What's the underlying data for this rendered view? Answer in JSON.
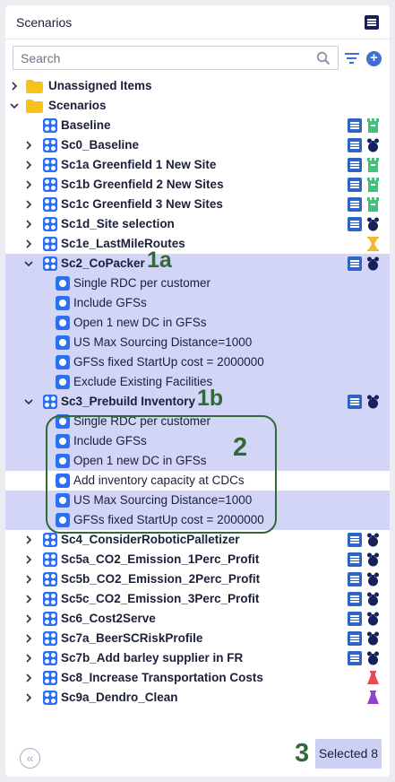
{
  "header": {
    "title": "Scenarios",
    "list_icon": "list-view-icon"
  },
  "search": {
    "placeholder": "Search",
    "value": ""
  },
  "tree": [
    {
      "kind": "folder",
      "label": "Unassigned Items",
      "expanded": false,
      "selected": false
    },
    {
      "kind": "folder",
      "label": "Scenarios",
      "expanded": true,
      "selected": false
    },
    {
      "kind": "scenario",
      "label": "Baseline",
      "has_children": false,
      "selected": false,
      "status": "green-tower"
    },
    {
      "kind": "scenario",
      "label": "Sc0_Baseline",
      "has_children": true,
      "selected": false,
      "status": "navy-bomb"
    },
    {
      "kind": "scenario",
      "label": "Sc1a Greenfield 1 New Site",
      "has_children": true,
      "selected": false,
      "status": "green-tower"
    },
    {
      "kind": "scenario",
      "label": "Sc1b Greenfield 2 New Sites",
      "has_children": true,
      "selected": false,
      "status": "green-tower"
    },
    {
      "kind": "scenario",
      "label": "Sc1c Greenfield 3 New Sites",
      "has_children": true,
      "selected": false,
      "status": "green-tower"
    },
    {
      "kind": "scenario",
      "label": "Sc1d_Site selection",
      "has_children": true,
      "selected": false,
      "status": "navy-bomb"
    },
    {
      "kind": "scenario",
      "label": "Sc1e_LastMileRoutes",
      "has_children": true,
      "selected": false,
      "status": "yellow-hourglass",
      "no_doc": true
    },
    {
      "kind": "scenario",
      "label": "Sc2_CoPacker",
      "has_children": true,
      "expanded": true,
      "selected": true,
      "status": "navy-bomb",
      "callout": "1a"
    },
    {
      "kind": "item",
      "label": "Single RDC per customer",
      "selected": true
    },
    {
      "kind": "item",
      "label": "Include GFSs",
      "selected": true
    },
    {
      "kind": "item",
      "label": "Open 1 new DC in GFSs",
      "selected": true
    },
    {
      "kind": "item",
      "label": "US Max Sourcing Distance=1000",
      "selected": true
    },
    {
      "kind": "item",
      "label": "GFSs fixed StartUp cost = 2000000",
      "selected": true
    },
    {
      "kind": "item",
      "label": "Exclude Existing Facilities",
      "selected": true
    },
    {
      "kind": "scenario",
      "label": "Sc3_Prebuild Inventory",
      "has_children": true,
      "expanded": true,
      "selected": true,
      "status": "navy-bomb",
      "callout": "1b"
    },
    {
      "kind": "item",
      "label": "Single RDC per customer",
      "selected": true
    },
    {
      "kind": "item",
      "label": "Include GFSs",
      "selected": true
    },
    {
      "kind": "item",
      "label": "Open 1 new DC in GFSs",
      "selected": true
    },
    {
      "kind": "item",
      "label": "Add inventory capacity at CDCs",
      "selected": false
    },
    {
      "kind": "item",
      "label": "US Max Sourcing Distance=1000",
      "selected": true
    },
    {
      "kind": "item",
      "label": "GFSs fixed StartUp cost = 2000000",
      "selected": true
    },
    {
      "kind": "scenario",
      "label": "Sc4_ConsiderRoboticPalletizer",
      "has_children": true,
      "selected": false,
      "status": "navy-bomb"
    },
    {
      "kind": "scenario",
      "label": "Sc5a_CO2_Emission_1Perc_Profit",
      "has_children": true,
      "selected": false,
      "status": "navy-bomb"
    },
    {
      "kind": "scenario",
      "label": "Sc5b_CO2_Emission_2Perc_Profit",
      "has_children": true,
      "selected": false,
      "status": "navy-bomb"
    },
    {
      "kind": "scenario",
      "label": "Sc5c_CO2_Emission_3Perc_Profit",
      "has_children": true,
      "selected": false,
      "status": "navy-bomb"
    },
    {
      "kind": "scenario",
      "label": "Sc6_Cost2Serve",
      "has_children": true,
      "selected": false,
      "status": "navy-bomb"
    },
    {
      "kind": "scenario",
      "label": "Sc7a_BeerSCRiskProfile",
      "has_children": true,
      "selected": false,
      "status": "navy-bomb"
    },
    {
      "kind": "scenario",
      "label": "Sc7b_Add barley supplier in FR",
      "has_children": true,
      "selected": false,
      "status": "navy-bomb"
    },
    {
      "kind": "scenario",
      "label": "Sc8_Increase Transportation Costs",
      "has_children": true,
      "selected": false,
      "status": "red-flask",
      "no_doc": true
    },
    {
      "kind": "scenario",
      "label": "Sc9a_Dendro_Clean",
      "has_children": true,
      "selected": false,
      "status": "purple-flask",
      "no_doc": true
    }
  ],
  "annotations": {
    "callout_2": "2",
    "callout_3": "3"
  },
  "footer": {
    "selected_label": "Selected 8",
    "back_icon": "double-chevron-left-icon"
  },
  "colors": {
    "selection": "#d3d5f6",
    "accent": "#2b6ff2",
    "callout": "#2f6a37",
    "green_status": "#3fc27a",
    "navy_status": "#16205a",
    "yellow_status": "#f2b632",
    "red_status": "#e54a57",
    "purple_status": "#8e44c8"
  }
}
